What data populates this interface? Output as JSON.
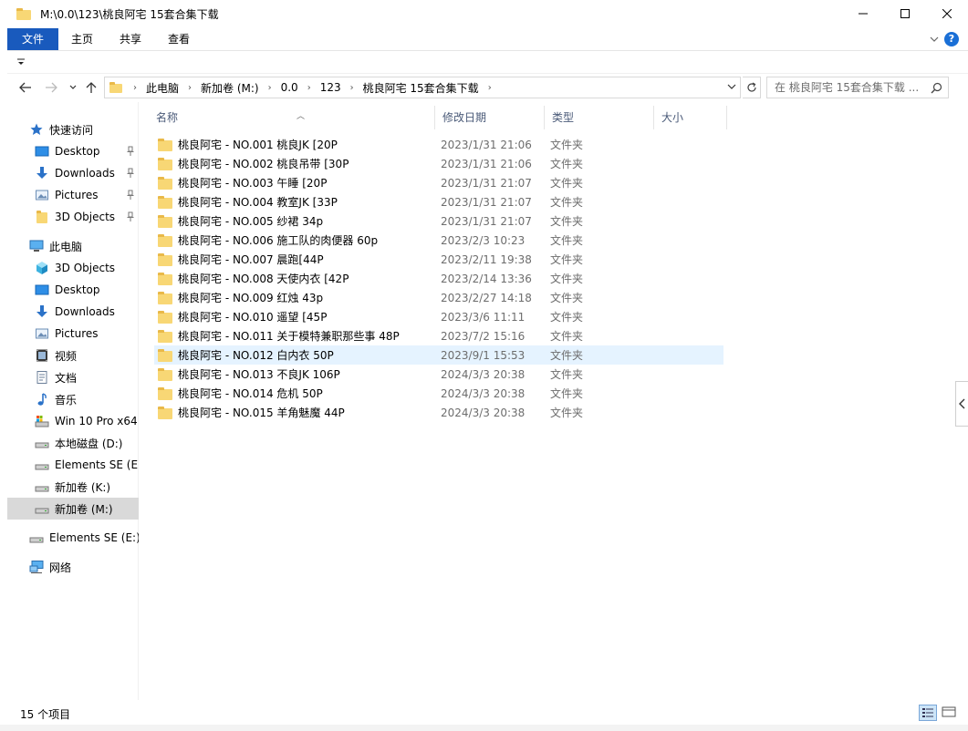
{
  "window": {
    "title": "M:\\0.0\\123\\桃良阿宅 15套合集下载"
  },
  "ribbon": {
    "tabs": [
      {
        "label": "文件"
      },
      {
        "label": "主页"
      },
      {
        "label": "共享"
      },
      {
        "label": "查看"
      }
    ],
    "help": "?"
  },
  "address": {
    "crumbs": [
      "此电脑",
      "新加卷 (M:)",
      "0.0",
      "123",
      "桃良阿宅 15套合集下载"
    ]
  },
  "search": {
    "placeholder": "在 桃良阿宅 15套合集下载 ..."
  },
  "nav": {
    "items": [
      {
        "label": "快速访问",
        "icon": "star-icon",
        "indent": 0,
        "pinned": false
      },
      {
        "label": "Desktop",
        "icon": "desktop-icon",
        "indent": 1,
        "pinned": true
      },
      {
        "label": "Downloads",
        "icon": "download-icon",
        "indent": 1,
        "pinned": true
      },
      {
        "label": "Pictures",
        "icon": "pictures-icon",
        "indent": 1,
        "pinned": true
      },
      {
        "label": "3D Objects",
        "icon": "folder-icon",
        "indent": 1,
        "pinned": true
      },
      {
        "label": "此电脑",
        "icon": "computer-icon",
        "indent": 0,
        "pinned": false
      },
      {
        "label": "3D Objects",
        "icon": "cube-icon",
        "indent": 1,
        "pinned": false
      },
      {
        "label": "Desktop",
        "icon": "desktop-icon",
        "indent": 1,
        "pinned": false
      },
      {
        "label": "Downloads",
        "icon": "download-icon",
        "indent": 1,
        "pinned": false
      },
      {
        "label": "Pictures",
        "icon": "pictures-icon",
        "indent": 1,
        "pinned": false
      },
      {
        "label": "视频",
        "icon": "video-icon",
        "indent": 1,
        "pinned": false
      },
      {
        "label": "文档",
        "icon": "document-icon",
        "indent": 1,
        "pinned": false
      },
      {
        "label": "音乐",
        "icon": "music-icon",
        "indent": 1,
        "pinned": false
      },
      {
        "label": "Win 10 Pro x64",
        "icon": "system-drive-icon",
        "indent": 1,
        "pinned": false
      },
      {
        "label": "本地磁盘 (D:)",
        "icon": "drive-icon",
        "indent": 1,
        "pinned": false
      },
      {
        "label": "Elements SE (E:",
        "icon": "drive-icon",
        "indent": 1,
        "pinned": false
      },
      {
        "label": "新加卷 (K:)",
        "icon": "drive-icon",
        "indent": 1,
        "pinned": false
      },
      {
        "label": "新加卷 (M:)",
        "icon": "drive-icon",
        "indent": 1,
        "pinned": false,
        "selected": true
      },
      {
        "label": "Elements SE (E:)",
        "icon": "drive-icon",
        "indent": 0,
        "pinned": false
      },
      {
        "label": "网络",
        "icon": "network-icon",
        "indent": 0,
        "pinned": false
      }
    ]
  },
  "columns": {
    "name": "名称",
    "date": "修改日期",
    "type": "类型",
    "size": "大小"
  },
  "files": [
    {
      "name": "桃良阿宅 - NO.001 桃良JK [20P",
      "date": "2023/1/31 21:06",
      "type": "文件夹"
    },
    {
      "name": "桃良阿宅 - NO.002 桃良吊带 [30P",
      "date": "2023/1/31 21:06",
      "type": "文件夹"
    },
    {
      "name": "桃良阿宅 - NO.003 午睡 [20P",
      "date": "2023/1/31 21:07",
      "type": "文件夹"
    },
    {
      "name": "桃良阿宅 - NO.004 教室JK [33P",
      "date": "2023/1/31 21:07",
      "type": "文件夹"
    },
    {
      "name": "桃良阿宅 - NO.005 纱裙 34p",
      "date": "2023/1/31 21:07",
      "type": "文件夹"
    },
    {
      "name": "桃良阿宅 - NO.006 施工队的肉便器 60p",
      "date": "2023/2/3 10:23",
      "type": "文件夹"
    },
    {
      "name": "桃良阿宅 - NO.007 晨跑[44P",
      "date": "2023/2/11 19:38",
      "type": "文件夹"
    },
    {
      "name": "桃良阿宅 - NO.008 天使内衣 [42P",
      "date": "2023/2/14 13:36",
      "type": "文件夹"
    },
    {
      "name": "桃良阿宅 - NO.009 红烛 43p",
      "date": "2023/2/27 14:18",
      "type": "文件夹"
    },
    {
      "name": "桃良阿宅 - NO.010 遥望 [45P",
      "date": "2023/3/6 11:11",
      "type": "文件夹"
    },
    {
      "name": "桃良阿宅 - NO.011 关于模特兼职那些事 48P",
      "date": "2023/7/2 15:16",
      "type": "文件夹"
    },
    {
      "name": "桃良阿宅 - NO.012 白内衣 50P",
      "date": "2023/9/1 15:53",
      "type": "文件夹",
      "selected": true
    },
    {
      "name": "桃良阿宅 - NO.013 不良JK 106P",
      "date": "2024/3/3 20:38",
      "type": "文件夹"
    },
    {
      "name": "桃良阿宅 - NO.014 危机 50P",
      "date": "2024/3/3 20:38",
      "type": "文件夹"
    },
    {
      "name": "桃良阿宅 - NO.015 羊角魅魔 44P",
      "date": "2024/3/3 20:38",
      "type": "文件夹"
    }
  ],
  "status": {
    "count": "15 个项目"
  },
  "colors": {
    "accent": "#195abd",
    "selection": "#e5f3ff",
    "nav_selected": "#d9d9d9",
    "folder": "#f8d775"
  }
}
